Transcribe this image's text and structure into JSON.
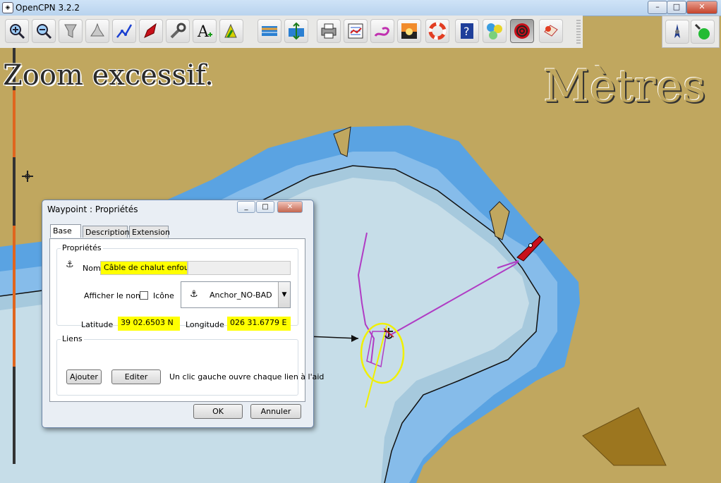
{
  "window": {
    "title": "OpenCPN 3.2.2",
    "minimize": "–",
    "maximize": "□",
    "close": "✕"
  },
  "toolbar": {
    "tools": [
      {
        "name": "zoom-in-icon"
      },
      {
        "name": "zoom-out-icon"
      },
      {
        "name": "scale-down-icon"
      },
      {
        "name": "scale-up-icon"
      },
      {
        "name": "route-icon"
      },
      {
        "name": "follow-ship-icon"
      },
      {
        "name": "settings-icon"
      },
      {
        "name": "text-toggle-icon"
      },
      {
        "name": "current-icon"
      },
      {
        "name": "tide-icon"
      },
      {
        "name": "tide-current-icon"
      },
      {
        "name": "print-icon"
      },
      {
        "name": "route-manager-icon"
      },
      {
        "name": "track-icon"
      },
      {
        "name": "color-scheme-icon"
      },
      {
        "name": "mob-icon"
      },
      {
        "name": "help-icon"
      },
      {
        "name": "ais-icon"
      },
      {
        "name": "anchor-alarm-icon"
      },
      {
        "name": "plugin-icon"
      }
    ]
  },
  "map": {
    "zoom_warning": "Zoom excessif.",
    "units": "Mètres",
    "colors": {
      "land": "#c0a75f",
      "deep_water": "#5aa3e2",
      "mid_water": "#86bcea",
      "shallow_water": "#a6c9dd",
      "route": "#b03cc4",
      "highlight": "#f0f000"
    }
  },
  "dialog": {
    "title": "Waypoint : Propriétés",
    "tabs": [
      "Base",
      "Description",
      "Extension"
    ],
    "section_properties": "Propriétés",
    "name_label": "Nom",
    "name_value": "Câble de chalut enfoui",
    "show_name_label": "Afficher le nom",
    "icon_label": "Icône",
    "icon_value": "Anchor_NO-BAD",
    "latitude_label": "Latitude",
    "latitude_value": "39 02.6503 N",
    "longitude_label": "Longitude",
    "longitude_value": "026 31.6779 E",
    "links_label": "Liens",
    "add_button": "Ajouter",
    "edit_button": "Editer",
    "links_hint": "Un clic gauche ouvre chaque lien à l'aid",
    "ok_button": "OK",
    "cancel_button": "Annuler"
  }
}
